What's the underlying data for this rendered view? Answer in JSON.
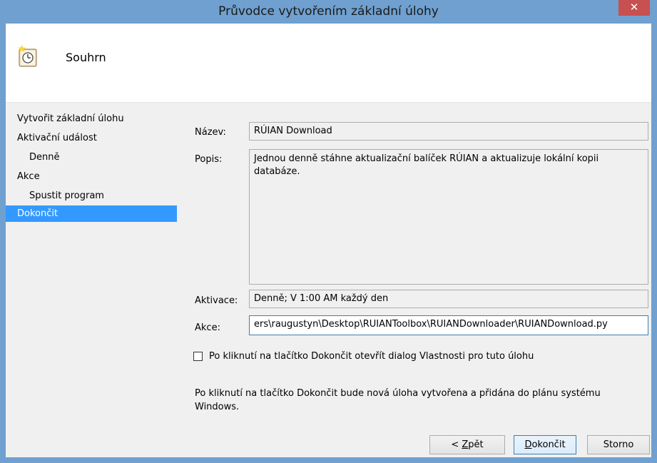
{
  "window": {
    "title": "Průvodce vytvořením základní úlohy",
    "close_glyph": "✕"
  },
  "header": {
    "heading": "Souhrn",
    "icon": "task-scheduler-clock-icon"
  },
  "steps": [
    {
      "label": "Vytvořit základní úlohu",
      "level": 0,
      "active": false
    },
    {
      "label": "Aktivační událost",
      "level": 0,
      "active": false
    },
    {
      "label": "Denně",
      "level": 1,
      "active": false
    },
    {
      "label": "Akce",
      "level": 0,
      "active": false
    },
    {
      "label": "Spustit program",
      "level": 1,
      "active": false
    },
    {
      "label": "Dokončit",
      "level": 0,
      "active": true
    }
  ],
  "summary": {
    "name_label": "Název:",
    "name_value": "RÚIAN Download",
    "description_label": "Popis:",
    "description_value": "Jednou denně stáhne aktualizační balíček RÚIAN a aktualizuje lokální kopii databáze.",
    "trigger_label": "Aktivace:",
    "trigger_value": "Denně; V 1:00 AM každý den",
    "action_label": "Akce:",
    "action_value": "ers\\raugustyn\\Desktop\\RUIANToolbox\\RUIANDownloader\\RUIANDownload.py"
  },
  "open_properties_checkbox": {
    "label": "Po kliknutí na tlačítko Dokončit otevřít dialog Vlastnosti pro tuto úlohu",
    "checked": false
  },
  "info_text": "Po kliknutí na tlačítko Dokončit bude nová úloha vytvořena a přidána do plánu systému Windows.",
  "buttons": {
    "back_prefix": "< ",
    "back_accel": "Z",
    "back_rest": "pět",
    "finish_accel": "D",
    "finish_rest": "okončit",
    "cancel": "Storno"
  },
  "colors": {
    "titlebar": "#6fa0cf",
    "close_button": "#c75050",
    "active_step": "#3399ff"
  }
}
